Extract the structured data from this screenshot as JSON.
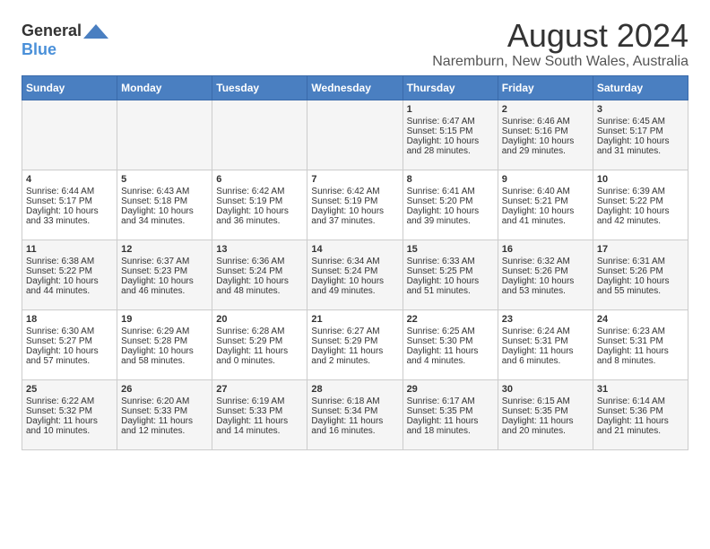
{
  "logo": {
    "general": "General",
    "blue": "Blue"
  },
  "title": "August 2024",
  "subtitle": "Naremburn, New South Wales, Australia",
  "days_of_week": [
    "Sunday",
    "Monday",
    "Tuesday",
    "Wednesday",
    "Thursday",
    "Friday",
    "Saturday"
  ],
  "weeks": [
    [
      {
        "day": "",
        "content": ""
      },
      {
        "day": "",
        "content": ""
      },
      {
        "day": "",
        "content": ""
      },
      {
        "day": "",
        "content": ""
      },
      {
        "day": "1",
        "content": "Sunrise: 6:47 AM\nSunset: 5:15 PM\nDaylight: 10 hours and 28 minutes."
      },
      {
        "day": "2",
        "content": "Sunrise: 6:46 AM\nSunset: 5:16 PM\nDaylight: 10 hours and 29 minutes."
      },
      {
        "day": "3",
        "content": "Sunrise: 6:45 AM\nSunset: 5:17 PM\nDaylight: 10 hours and 31 minutes."
      }
    ],
    [
      {
        "day": "4",
        "content": "Sunrise: 6:44 AM\nSunset: 5:17 PM\nDaylight: 10 hours and 33 minutes."
      },
      {
        "day": "5",
        "content": "Sunrise: 6:43 AM\nSunset: 5:18 PM\nDaylight: 10 hours and 34 minutes."
      },
      {
        "day": "6",
        "content": "Sunrise: 6:42 AM\nSunset: 5:19 PM\nDaylight: 10 hours and 36 minutes."
      },
      {
        "day": "7",
        "content": "Sunrise: 6:42 AM\nSunset: 5:19 PM\nDaylight: 10 hours and 37 minutes."
      },
      {
        "day": "8",
        "content": "Sunrise: 6:41 AM\nSunset: 5:20 PM\nDaylight: 10 hours and 39 minutes."
      },
      {
        "day": "9",
        "content": "Sunrise: 6:40 AM\nSunset: 5:21 PM\nDaylight: 10 hours and 41 minutes."
      },
      {
        "day": "10",
        "content": "Sunrise: 6:39 AM\nSunset: 5:22 PM\nDaylight: 10 hours and 42 minutes."
      }
    ],
    [
      {
        "day": "11",
        "content": "Sunrise: 6:38 AM\nSunset: 5:22 PM\nDaylight: 10 hours and 44 minutes."
      },
      {
        "day": "12",
        "content": "Sunrise: 6:37 AM\nSunset: 5:23 PM\nDaylight: 10 hours and 46 minutes."
      },
      {
        "day": "13",
        "content": "Sunrise: 6:36 AM\nSunset: 5:24 PM\nDaylight: 10 hours and 48 minutes."
      },
      {
        "day": "14",
        "content": "Sunrise: 6:34 AM\nSunset: 5:24 PM\nDaylight: 10 hours and 49 minutes."
      },
      {
        "day": "15",
        "content": "Sunrise: 6:33 AM\nSunset: 5:25 PM\nDaylight: 10 hours and 51 minutes."
      },
      {
        "day": "16",
        "content": "Sunrise: 6:32 AM\nSunset: 5:26 PM\nDaylight: 10 hours and 53 minutes."
      },
      {
        "day": "17",
        "content": "Sunrise: 6:31 AM\nSunset: 5:26 PM\nDaylight: 10 hours and 55 minutes."
      }
    ],
    [
      {
        "day": "18",
        "content": "Sunrise: 6:30 AM\nSunset: 5:27 PM\nDaylight: 10 hours and 57 minutes."
      },
      {
        "day": "19",
        "content": "Sunrise: 6:29 AM\nSunset: 5:28 PM\nDaylight: 10 hours and 58 minutes."
      },
      {
        "day": "20",
        "content": "Sunrise: 6:28 AM\nSunset: 5:29 PM\nDaylight: 11 hours and 0 minutes."
      },
      {
        "day": "21",
        "content": "Sunrise: 6:27 AM\nSunset: 5:29 PM\nDaylight: 11 hours and 2 minutes."
      },
      {
        "day": "22",
        "content": "Sunrise: 6:25 AM\nSunset: 5:30 PM\nDaylight: 11 hours and 4 minutes."
      },
      {
        "day": "23",
        "content": "Sunrise: 6:24 AM\nSunset: 5:31 PM\nDaylight: 11 hours and 6 minutes."
      },
      {
        "day": "24",
        "content": "Sunrise: 6:23 AM\nSunset: 5:31 PM\nDaylight: 11 hours and 8 minutes."
      }
    ],
    [
      {
        "day": "25",
        "content": "Sunrise: 6:22 AM\nSunset: 5:32 PM\nDaylight: 11 hours and 10 minutes."
      },
      {
        "day": "26",
        "content": "Sunrise: 6:20 AM\nSunset: 5:33 PM\nDaylight: 11 hours and 12 minutes."
      },
      {
        "day": "27",
        "content": "Sunrise: 6:19 AM\nSunset: 5:33 PM\nDaylight: 11 hours and 14 minutes."
      },
      {
        "day": "28",
        "content": "Sunrise: 6:18 AM\nSunset: 5:34 PM\nDaylight: 11 hours and 16 minutes."
      },
      {
        "day": "29",
        "content": "Sunrise: 6:17 AM\nSunset: 5:35 PM\nDaylight: 11 hours and 18 minutes."
      },
      {
        "day": "30",
        "content": "Sunrise: 6:15 AM\nSunset: 5:35 PM\nDaylight: 11 hours and 20 minutes."
      },
      {
        "day": "31",
        "content": "Sunrise: 6:14 AM\nSunset: 5:36 PM\nDaylight: 11 hours and 21 minutes."
      }
    ]
  ]
}
